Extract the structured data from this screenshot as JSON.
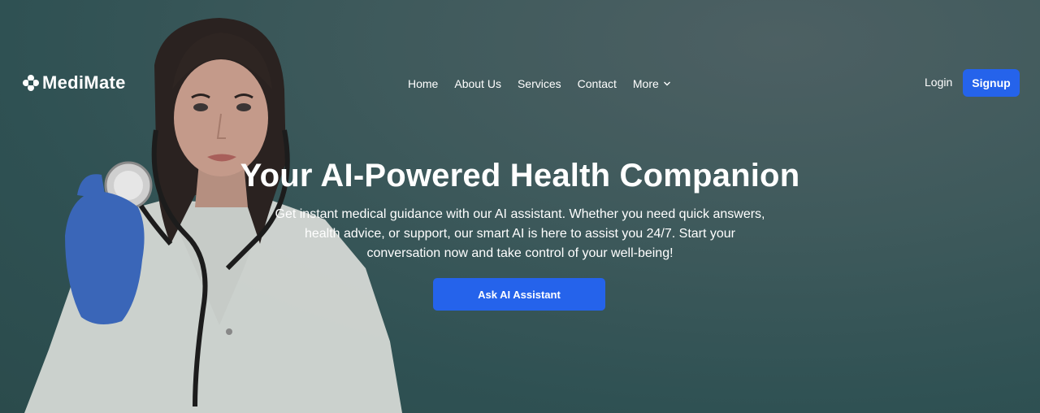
{
  "brand": {
    "name": "MediMate",
    "icon": "medical-cross-icon"
  },
  "nav": {
    "items": [
      "Home",
      "About Us",
      "Services",
      "Contact"
    ],
    "more_label": "More"
  },
  "auth": {
    "login_label": "Login",
    "signup_label": "Signup"
  },
  "hero": {
    "title": "Your AI-Powered Health Companion",
    "subtitle": "Get instant medical guidance with our AI assistant. Whether you need quick answers, health advice, or support, our smart AI is here to assist you 24/7. Start your conversation now and take control of your well-being!",
    "cta_label": "Ask AI Assistant"
  },
  "colors": {
    "primary": "#2563eb",
    "background": "#2f5153",
    "text": "#ffffff"
  }
}
